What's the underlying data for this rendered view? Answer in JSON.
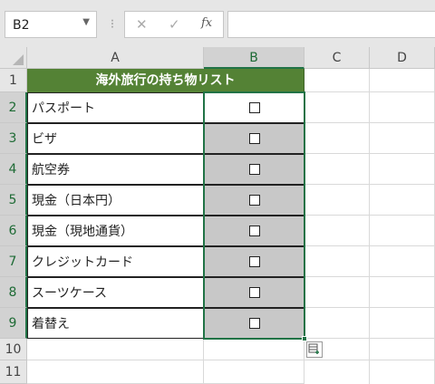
{
  "name_box": {
    "value": "B2"
  },
  "formula_bar": {
    "divider": "⁝",
    "cancel_icon": "✕",
    "enter_icon": "✓",
    "function_label": "fx",
    "value": ""
  },
  "columns": [
    "A",
    "B",
    "C",
    "D"
  ],
  "rows": [
    "1",
    "2",
    "3",
    "4",
    "5",
    "6",
    "7",
    "8",
    "9",
    "10",
    "11"
  ],
  "sheet": {
    "title": "海外旅行の持ち物リスト",
    "items": [
      "パスポート",
      "ビザ",
      "航空券",
      "現金（日本円）",
      "現金（現地通貨）",
      "クレジットカード",
      "スーツケース",
      "着替え"
    ],
    "checkbox_glyph": "",
    "title_bg": "#548235",
    "checkbox_column_bg": "#c8c8c8",
    "selection_color": "#217346"
  }
}
